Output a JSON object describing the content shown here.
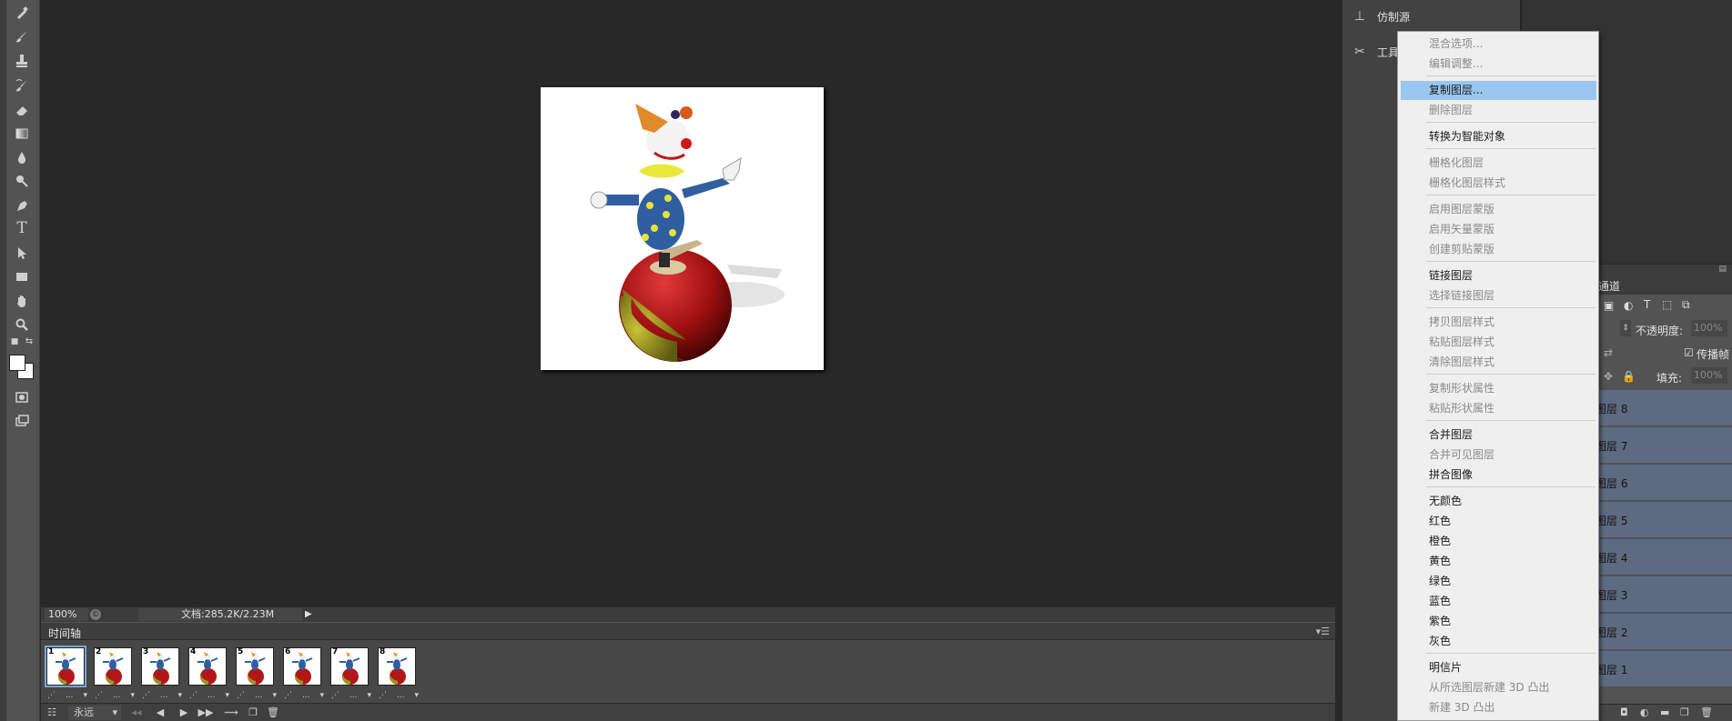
{
  "toolbar": {
    "tools": [
      "healing-brush-icon",
      "brush-icon",
      "clone-stamp-icon",
      "history-brush-icon",
      "eraser-icon",
      "gradient-icon",
      "blur-icon",
      "dodge-icon",
      "pen-icon",
      "type-icon",
      "path-selection-icon",
      "rectangle-shape-icon",
      "hand-icon",
      "zoom-icon"
    ],
    "type_tool_glyph": "T"
  },
  "status": {
    "zoom": "100%",
    "doc_info": "文档:285.2K/2.23M"
  },
  "timeline": {
    "title": "时间轴",
    "frames": [
      {
        "num": "1",
        "delay": "..."
      },
      {
        "num": "2",
        "delay": "..."
      },
      {
        "num": "3",
        "delay": "..."
      },
      {
        "num": "4",
        "delay": "..."
      },
      {
        "num": "5",
        "delay": "..."
      },
      {
        "num": "6",
        "delay": "..."
      },
      {
        "num": "7",
        "delay": "..."
      },
      {
        "num": "8",
        "delay": "..."
      }
    ],
    "loop": "永远"
  },
  "panels": {
    "clone_source": "仿制源",
    "tool_presets": "工具"
  },
  "layers": {
    "tab_label": "通道",
    "opacity_label": "不透明度:",
    "opacity_value": "100%",
    "propagate_label": "传播帧",
    "fill_label": "填充:",
    "fill_value": "100%",
    "rows": [
      "图层 8",
      "图层 7",
      "图层 6",
      "图层 5",
      "图层 4",
      "图层 3",
      "图层 2",
      "图层 1"
    ]
  },
  "context_menu": {
    "items": [
      {
        "label": "混合选项...",
        "state": "disabled"
      },
      {
        "label": "编辑调整...",
        "state": "disabled"
      },
      {
        "label": "复制图层...",
        "state": "highlighted"
      },
      {
        "label": "删除图层",
        "state": "disabled"
      },
      {
        "label": "转换为智能对象",
        "state": "enabled"
      },
      {
        "label": "栅格化图层",
        "state": "disabled"
      },
      {
        "label": "栅格化图层样式",
        "state": "disabled"
      },
      {
        "label": "启用图层蒙版",
        "state": "disabled"
      },
      {
        "label": "启用矢量蒙版",
        "state": "disabled"
      },
      {
        "label": "创建剪贴蒙版",
        "state": "disabled"
      },
      {
        "label": "链接图层",
        "state": "enabled"
      },
      {
        "label": "选择链接图层",
        "state": "disabled"
      },
      {
        "label": "拷贝图层样式",
        "state": "disabled"
      },
      {
        "label": "粘贴图层样式",
        "state": "disabled"
      },
      {
        "label": "清除图层样式",
        "state": "disabled"
      },
      {
        "label": "复制形状属性",
        "state": "disabled"
      },
      {
        "label": "粘贴形状属性",
        "state": "disabled"
      },
      {
        "label": "合并图层",
        "state": "enabled"
      },
      {
        "label": "合并可见图层",
        "state": "disabled"
      },
      {
        "label": "拼合图像",
        "state": "enabled"
      },
      {
        "label": "无颜色",
        "state": "enabled"
      },
      {
        "label": "红色",
        "state": "enabled"
      },
      {
        "label": "橙色",
        "state": "enabled"
      },
      {
        "label": "黄色",
        "state": "enabled"
      },
      {
        "label": "绿色",
        "state": "enabled"
      },
      {
        "label": "蓝色",
        "state": "enabled"
      },
      {
        "label": "紫色",
        "state": "enabled"
      },
      {
        "label": "灰色",
        "state": "enabled"
      },
      {
        "label": "明信片",
        "state": "enabled"
      },
      {
        "label": "从所选图层新建 3D 凸出",
        "state": "disabled"
      },
      {
        "label": "新建 3D 凸出",
        "state": "disabled"
      }
    ]
  }
}
